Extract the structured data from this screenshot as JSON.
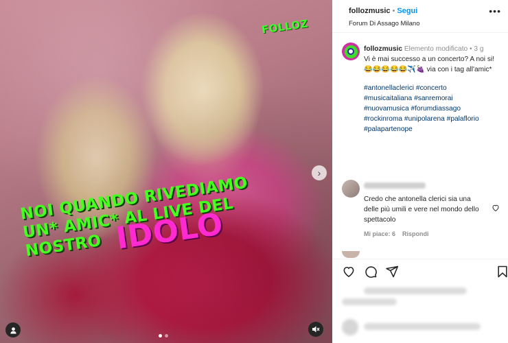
{
  "media": {
    "watermark": "FOLLOZ",
    "caption_lines": [
      "NOI QUANDO RIVEDIAMO",
      "UN* AMIC* AL LIVE DEL",
      "NOSTRO"
    ],
    "caption_highlight": "IDOLO",
    "caption_colors": {
      "main": "#47ff1e",
      "highlight": "#ff2bd0"
    },
    "next_icon": "chevron-right-icon",
    "carousel": {
      "total": 2,
      "active": 1
    }
  },
  "header": {
    "username": "follozmusic",
    "separator": "•",
    "follow_label": "Segui",
    "location": "Forum Di Assago Milano",
    "more_label": "•••"
  },
  "post": {
    "username": "follozmusic",
    "meta": "Elemento modificato • 3 g",
    "text_line1": "Vi è mai successo a un concerto? A noi si!",
    "emoji_line": "😂😂😂😂😂✈️🍇 via con i tag all'amic*",
    "hashtags": [
      "#antonellaclerici",
      "#concerto",
      "#musicaitaliana",
      "#sanremorai",
      "#nuovamusica",
      "#forumdiassago",
      "#rockinroma",
      "#unipolarena",
      "#palaflorio",
      "#palapartenope"
    ]
  },
  "comment": {
    "text": "Credo che antonella clerici sia una delle più umili e vere nel mondo dello spettacolo",
    "likes": "Mi piace: 6",
    "reply": "Rispondi"
  },
  "colors": {
    "link": "#0095f6",
    "hashtag": "#00376b",
    "meta": "#8e8e8e"
  }
}
